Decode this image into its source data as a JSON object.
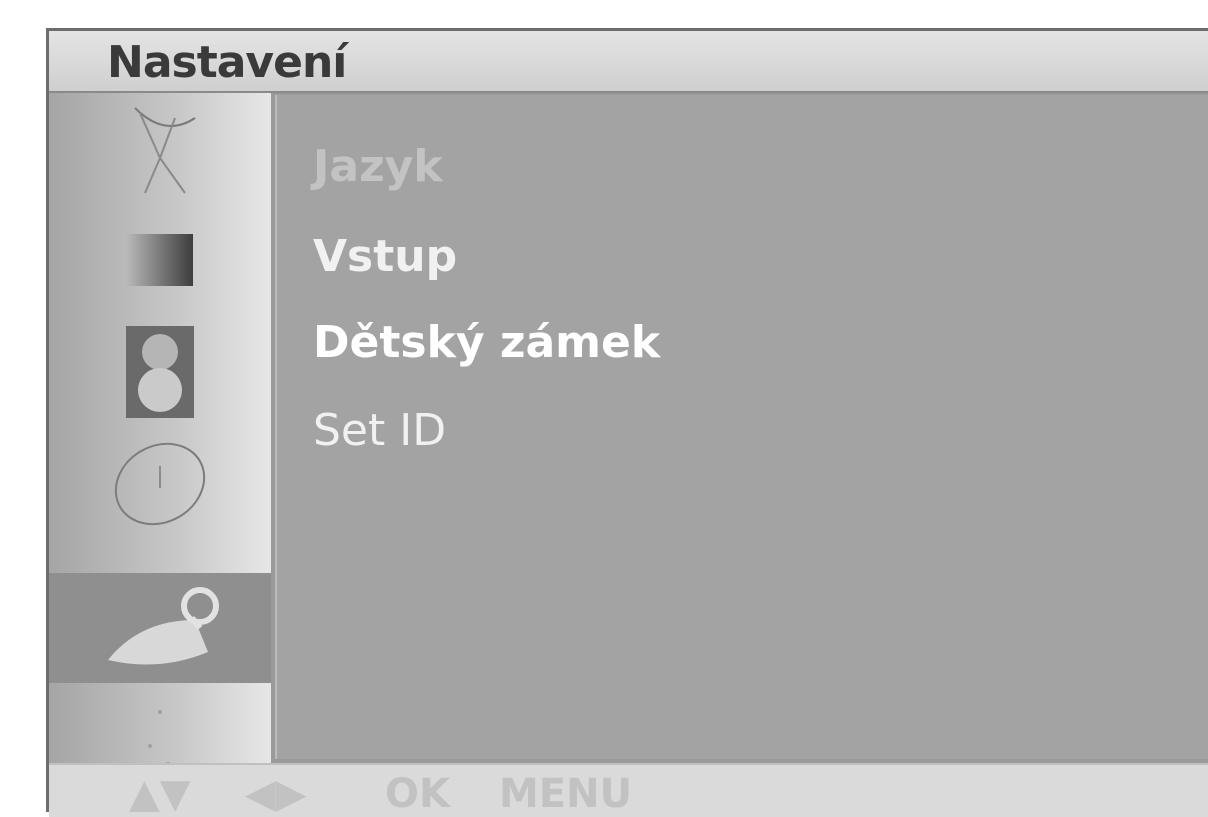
{
  "window": {
    "title": "Nastavení"
  },
  "sidebar": {
    "items": [
      {
        "icon": "satellite-dish-icon",
        "selected": false
      },
      {
        "icon": "picture-icon",
        "selected": false
      },
      {
        "icon": "speaker-icon",
        "selected": false
      },
      {
        "icon": "clock-icon",
        "selected": false
      },
      {
        "icon": "key-icon",
        "selected": true
      },
      {
        "icon": "dots-icon",
        "selected": false
      }
    ]
  },
  "menu": {
    "items": [
      {
        "label": "Jazyk"
      },
      {
        "label": "Vstup"
      },
      {
        "label": "Dětský zámek"
      },
      {
        "label": "Set ID"
      }
    ]
  },
  "footer": {
    "nav_up_down": "▲▼",
    "nav_left_right": "◀▶",
    "ok_label": "OK",
    "menu_label": "MENU"
  }
}
